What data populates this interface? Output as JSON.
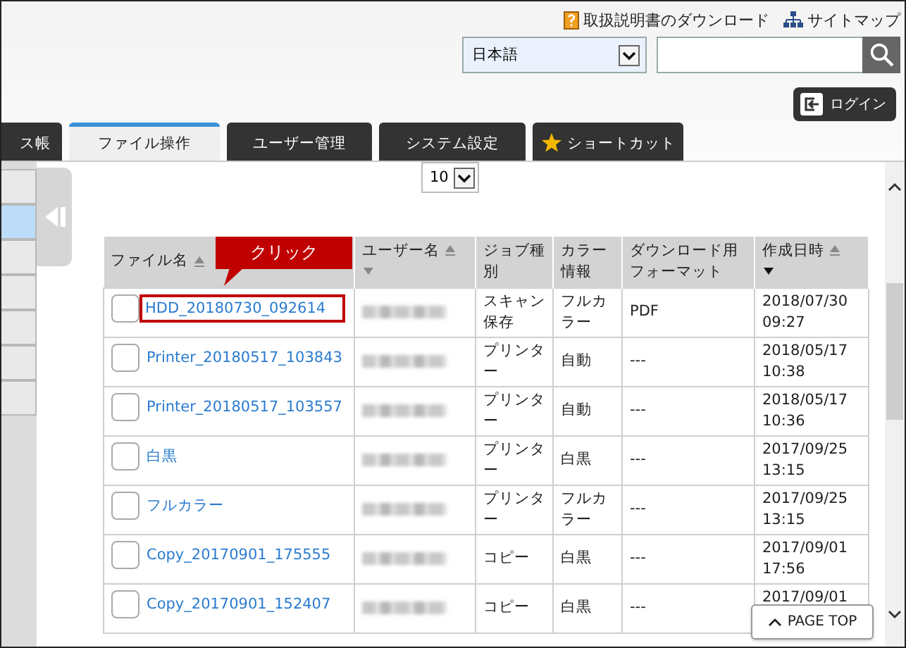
{
  "header_links": [
    {
      "kind": "manual",
      "label": "取扱説明書のダウンロード"
    },
    {
      "kind": "sitemap",
      "label": "サイトマップ"
    }
  ],
  "language_select": {
    "value": "日本語"
  },
  "login_button": {
    "label": "ログイン"
  },
  "tabs": [
    {
      "label": "ス帳",
      "selected": false,
      "kind": "plain"
    },
    {
      "label": "ファイル操作",
      "selected": true,
      "kind": "plain"
    },
    {
      "label": "ユーザー管理",
      "selected": false,
      "kind": "plain"
    },
    {
      "label": "システム設定",
      "selected": false,
      "kind": "plain"
    },
    {
      "label": "ショートカット",
      "selected": false,
      "kind": "shortcut"
    }
  ],
  "sidebar": {
    "items": [
      {
        "selected": false
      },
      {
        "selected": true
      },
      {
        "selected": false
      },
      {
        "selected": false
      },
      {
        "selected": false
      },
      {
        "selected": false
      },
      {
        "selected": false
      }
    ]
  },
  "page_size_select": {
    "value": "10"
  },
  "callout": {
    "text": "クリック"
  },
  "table": {
    "columns": [
      {
        "label": "ファイル名",
        "kind": "sortup"
      },
      {
        "label": "ユーザー名",
        "kind": "sortboth",
        "sort_desc": false
      },
      {
        "label": "ジョブ種別",
        "kind": "plain"
      },
      {
        "label": "カラー情報",
        "kind": "plain"
      },
      {
        "label": "ダウンロード用フォーマット",
        "kind": "plain"
      },
      {
        "label": "作成日時",
        "kind": "sortboth",
        "sort_desc": true
      }
    ],
    "rows": [
      {
        "checked": false,
        "highlighted": true,
        "file": "HDD_20180730_092614",
        "job": "スキャン保存",
        "color_mode": "フルカラー",
        "format": "PDF",
        "created": "2018/07/30 09:27"
      },
      {
        "checked": false,
        "highlighted": false,
        "file": "Printer_20180517_103843",
        "job": "プリンター",
        "color_mode": "自動",
        "format": "---",
        "created": "2018/05/17 10:38"
      },
      {
        "checked": false,
        "highlighted": false,
        "file": "Printer_20180517_103557",
        "job": "プリンター",
        "color_mode": "自動",
        "format": "---",
        "created": "2018/05/17 10:36"
      },
      {
        "checked": false,
        "highlighted": false,
        "file": "白黒",
        "job": "プリンター",
        "color_mode": "白黒",
        "format": "---",
        "created": "2017/09/25 13:15"
      },
      {
        "checked": false,
        "highlighted": false,
        "file": "フルカラー",
        "job": "プリンター",
        "color_mode": "フルカラー",
        "format": "---",
        "created": "2017/09/25 13:15"
      },
      {
        "checked": false,
        "highlighted": false,
        "file": "Copy_20170901_175555",
        "job": "コピー",
        "color_mode": "白黒",
        "format": "---",
        "created": "2017/09/01 17:56"
      },
      {
        "checked": false,
        "highlighted": false,
        "file": "Copy_20170901_152407",
        "job": "コピー",
        "color_mode": "白黒",
        "format": "---",
        "created": "2017/09/01"
      }
    ]
  },
  "page_top_button": {
    "label": "PAGE TOP"
  }
}
